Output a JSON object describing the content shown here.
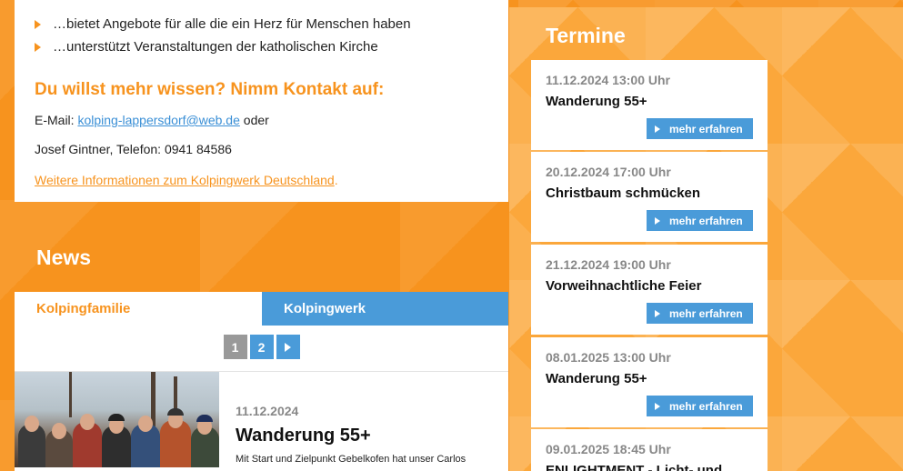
{
  "info": {
    "bullets": [
      "…bietet Angebote für alle die ein Herz für Menschen haben",
      "…unterstützt Veranstaltungen der katholischen Kirche"
    ],
    "contact_heading": "Du willst mehr wissen? Nimm Kontakt auf:",
    "email_prefix": "E-Mail: ",
    "email": "kolping-lappersdorf@web.de",
    "email_suffix": " oder",
    "phone_line": "Josef Gintner, Telefon: 0941 84586",
    "more_link": "Weitere Informationen zum Kolpingwerk Deutschland",
    "more_link_suffix": "."
  },
  "news": {
    "title": "News",
    "tabs": [
      "Kolpingfamilie",
      "Kolpingwerk"
    ],
    "pages": [
      "1",
      "2"
    ],
    "item": {
      "date": "11.12.2024",
      "headline": "Wanderung 55+",
      "excerpt": "Mit Start und Zielpunkt Gebelkofen hat unser Carlos"
    }
  },
  "termine": {
    "title": "Termine",
    "button_label": "mehr erfahren",
    "events": [
      {
        "date": "11.12.2024 13:00 Uhr",
        "title": "Wanderung 55+"
      },
      {
        "date": "20.12.2024 17:00 Uhr",
        "title": "Christbaum schmücken"
      },
      {
        "date": "21.12.2024 19:00 Uhr",
        "title": "Vorweihnachtliche Feier"
      },
      {
        "date": "08.01.2025 13:00 Uhr",
        "title": "Wanderung 55+"
      },
      {
        "date": "09.01.2025 18:45 Uhr",
        "title": "ENLIGHTMENT - Licht- und"
      }
    ]
  },
  "colors": {
    "accent_orange": "#f7931e",
    "accent_blue": "#4a9bd9"
  }
}
